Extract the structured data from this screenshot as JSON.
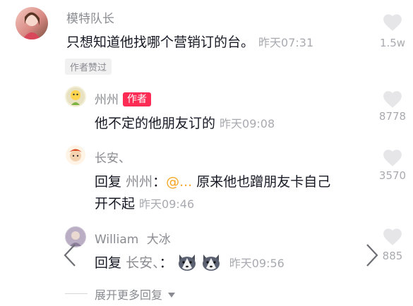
{
  "comments": [
    {
      "user": "模特队长",
      "text": "只想知道他找哪个营销订的台。",
      "time": "昨天07:31",
      "likes": "1.5w",
      "author_liked_label": "作者赞过"
    }
  ],
  "replies": [
    {
      "user": "州州",
      "author_badge": "作者",
      "text": "他不定的他朋友订的",
      "time": "昨天09:08",
      "likes": "8778"
    },
    {
      "user": "长安、",
      "reply_prefix": "回复",
      "reply_to": "州州",
      "separator": "：",
      "mention": "@...",
      "text_line1": "原来他也蹭朋友卡自己",
      "text_line2": "开不起",
      "time": "昨天09:46",
      "likes": "3570"
    },
    {
      "user": "William",
      "user_suffix": "大冰",
      "reply_prefix": "回复",
      "reply_to": "长安、",
      "separator": "：",
      "time": "昨天09:56",
      "likes": "885"
    }
  ],
  "expand_more_label": "展开更多回复",
  "icons": {
    "like": "heart-outline-icon",
    "nav_prev": "chevron-left-icon",
    "nav_next": "chevron-right-icon",
    "expand": "caret-down-icon",
    "emoji": "husky-emoji-icon"
  },
  "colors": {
    "author_badge": "#fe2c55",
    "mention": "#f5a623",
    "secondary_text": "#8a8b91"
  }
}
